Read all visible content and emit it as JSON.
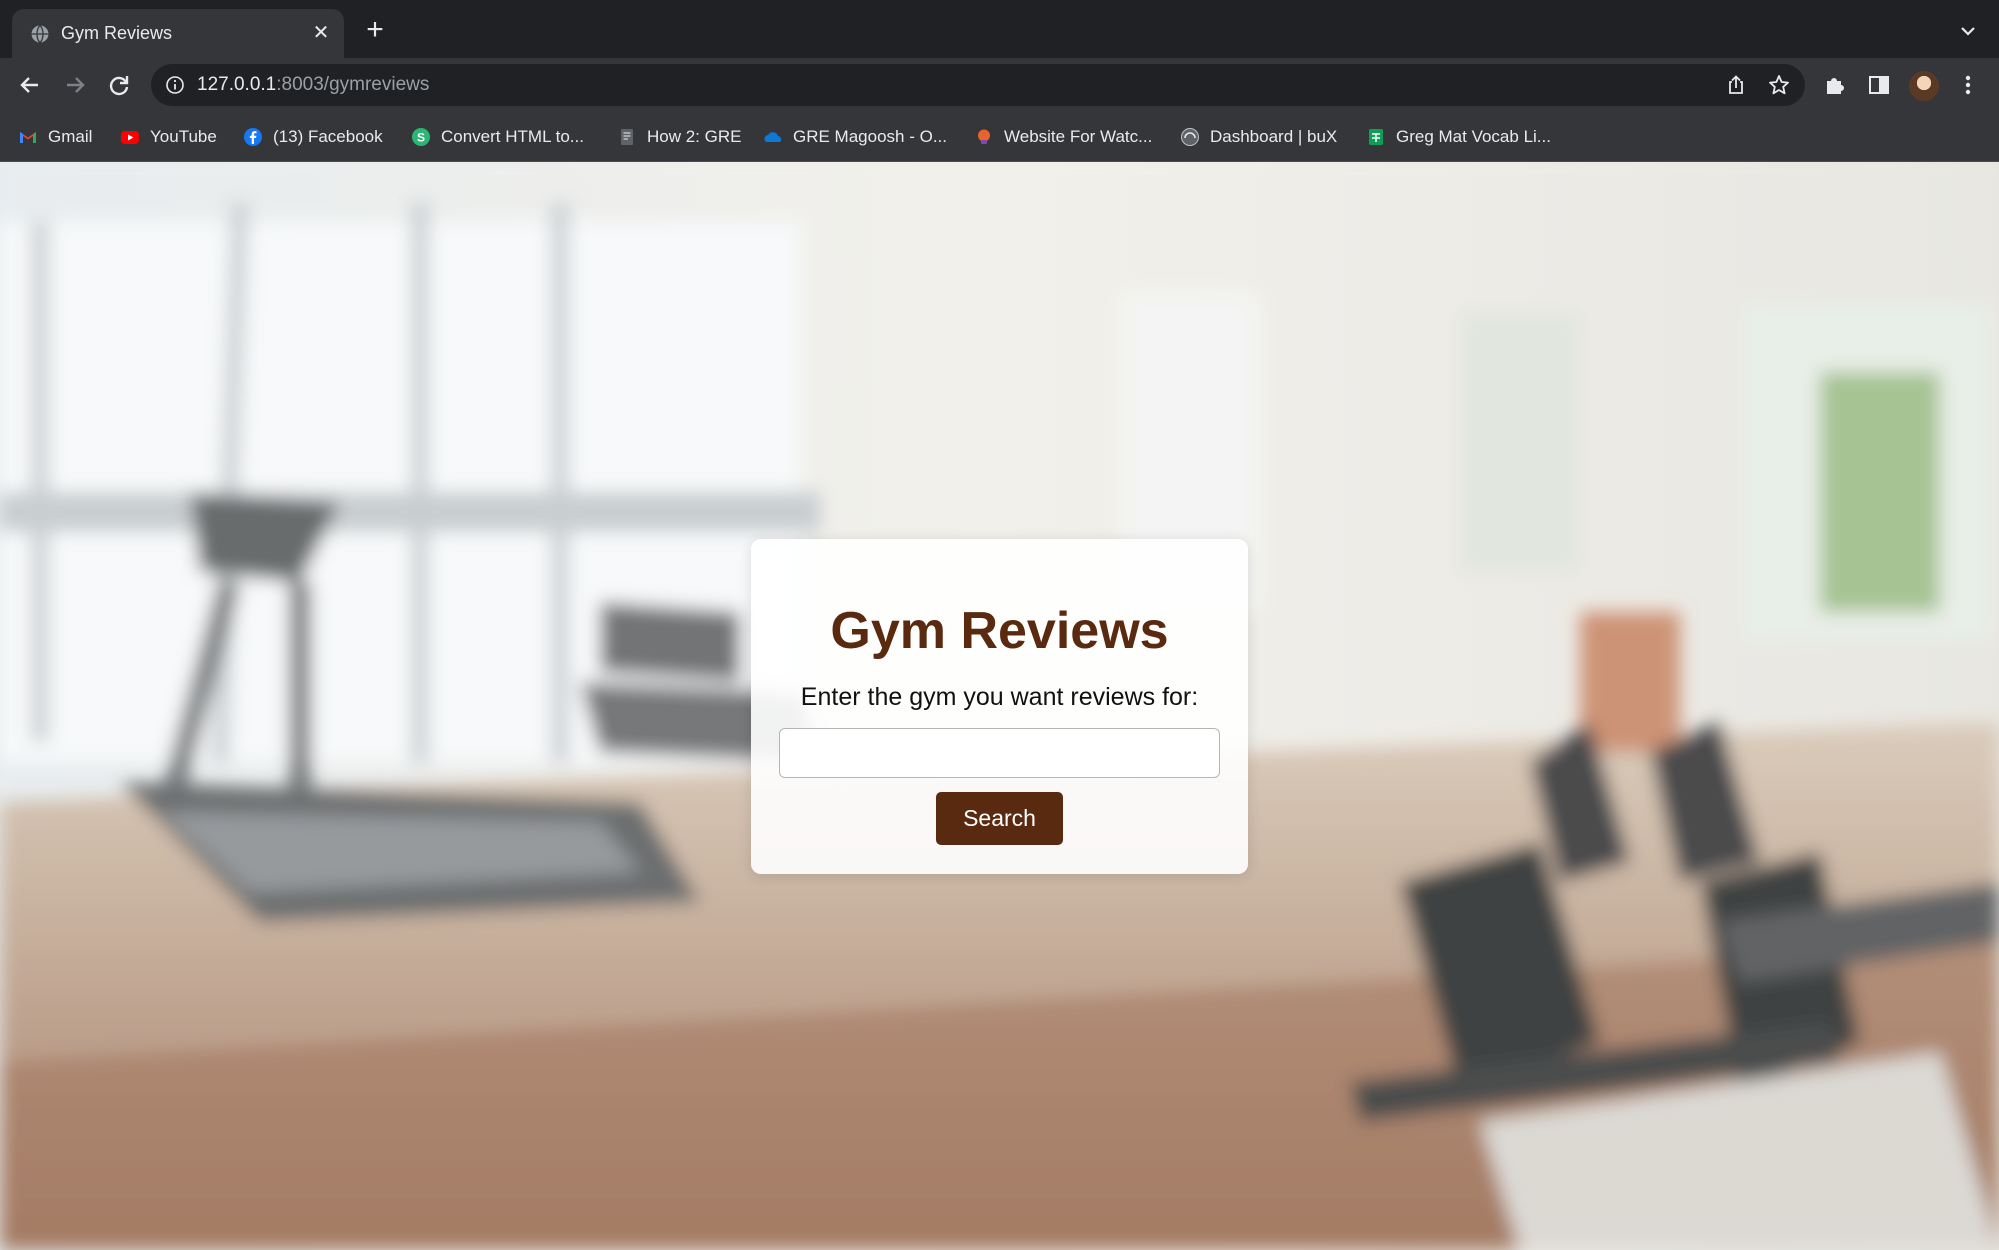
{
  "browser": {
    "tab": {
      "title": "Gym Reviews"
    },
    "address": {
      "host": "127.0.0.1",
      "path": ":8003/gymreviews"
    },
    "bookmarks": [
      {
        "label": "Gmail",
        "icon": "gmail-icon"
      },
      {
        "label": "YouTube",
        "icon": "youtube-icon"
      },
      {
        "label": "(13) Facebook",
        "icon": "facebook-icon"
      },
      {
        "label": "Convert HTML to...",
        "icon": "convert-icon"
      },
      {
        "label": "How 2: GRE",
        "icon": "doc-icon"
      },
      {
        "label": "GRE Magoosh - O...",
        "icon": "onedrive-icon"
      },
      {
        "label": "Website For Watc...",
        "icon": "website-icon"
      },
      {
        "label": "Dashboard | buX",
        "icon": "dashboard-icon"
      },
      {
        "label": "Greg Mat Vocab Li...",
        "icon": "sheets-icon"
      }
    ]
  },
  "page": {
    "heading": "Gym Reviews",
    "prompt": "Enter the gym you want reviews for:",
    "search_value": "",
    "search_button": "Search"
  },
  "colors": {
    "accent": "#5a2a10",
    "chrome_dark": "#202124",
    "chrome": "#35363a"
  }
}
